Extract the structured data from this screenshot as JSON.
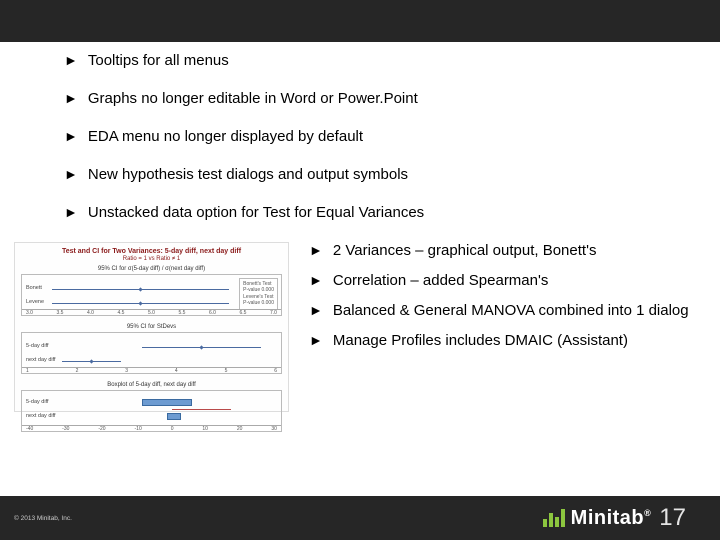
{
  "bullets_main": [
    "Tooltips for all menus",
    "Graphs no longer editable in Word or Power.Point",
    "EDA menu no longer displayed by default",
    "New hypothesis test dialogs and output symbols",
    "Unstacked data option for Test for Equal Variances"
  ],
  "bullets_side": [
    "2 Variances – graphical output, Bonett's",
    "Correlation – added Spearman's",
    "Balanced & General MANOVA combined into 1 dialog",
    "Manage Profiles includes DMAIC (Assistant)"
  ],
  "chart": {
    "title": "Test and CI for Two Variances: 5-day diff, next day diff",
    "subtitle": "Ratio = 1 vs Ratio ≠ 1",
    "panel1_label": "95% CI for σ(5-day diff) / σ(next day diff)",
    "panel1_rows": [
      "Bonett",
      "Levene"
    ],
    "panel1_ticks": [
      "3.0",
      "3.5",
      "4.0",
      "4.5",
      "5.0",
      "5.5",
      "6.0",
      "6.5",
      "7.0"
    ],
    "legend_title": "Bonett's Test",
    "legend_rows": [
      "P-value  0.000",
      "Levene's Test",
      "P-value  0.000"
    ],
    "panel2_label": "95% CI for StDevs",
    "panel2_rows": [
      "5-day diff",
      "next day diff"
    ],
    "panel2_ticks": [
      "1",
      "2",
      "3",
      "4",
      "5",
      "6"
    ],
    "panel3_label": "Boxplot of 5-day diff, next day diff",
    "panel3_rows": [
      "5-day diff",
      "next day diff"
    ],
    "panel3_ticks": [
      "-40",
      "-30",
      "-20",
      "-10",
      "0",
      "10",
      "20",
      "30"
    ]
  },
  "footer": {
    "copyright": "© 2013 Minitab, Inc.",
    "brand": "Minitab",
    "version": "17"
  }
}
